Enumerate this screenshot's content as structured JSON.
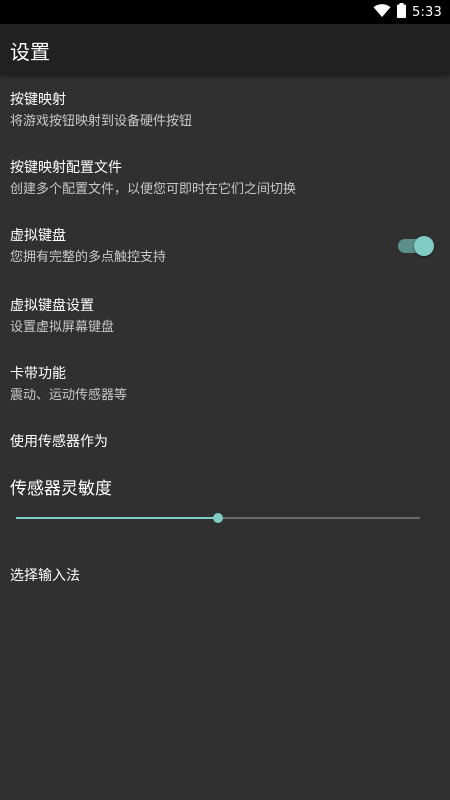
{
  "status_bar": {
    "time": "5:33",
    "icons": [
      "wifi-icon",
      "battery-icon"
    ]
  },
  "app_bar": {
    "title": "设置"
  },
  "preferences": [
    {
      "title": "按键映射",
      "summary": "将游戏按钮映射到设备硬件按钮"
    },
    {
      "title": "按键映射配置文件",
      "summary": "创建多个配置文件，以便您可即时在它们之间切换"
    },
    {
      "title": "虚拟键盘",
      "summary": "您拥有完整的多点触控支持",
      "switch_on": true
    },
    {
      "title": "虚拟键盘设置",
      "summary": "设置虚拟屏幕键盘"
    },
    {
      "title": "卡带功能",
      "summary": "震动、运动传感器等"
    },
    {
      "title": "使用传感器作为"
    }
  ],
  "sensitivity": {
    "title": "传感器灵敏度",
    "value": 0.5
  },
  "input_method": {
    "title": "选择输入法"
  },
  "colors": {
    "accent": "#80cbc4",
    "background": "#303030",
    "app_bar": "#212121"
  }
}
